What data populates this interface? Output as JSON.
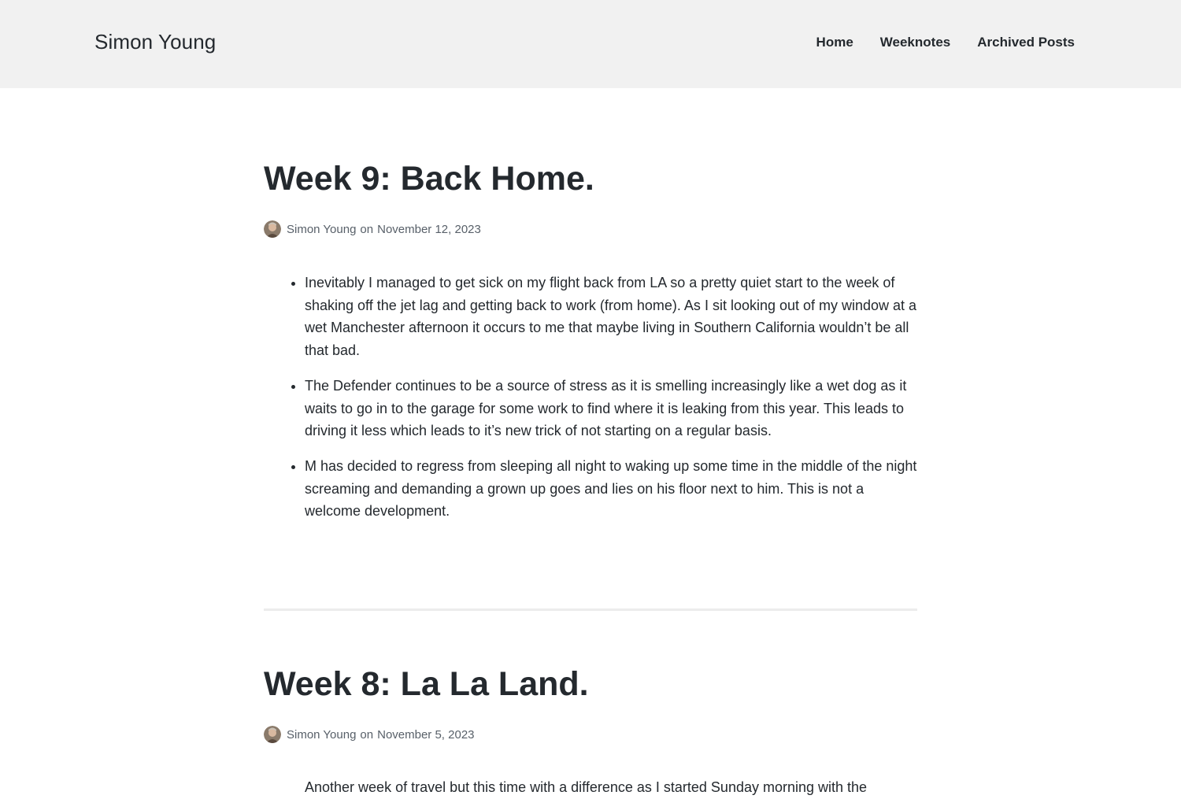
{
  "header": {
    "site_title": "Simon Young",
    "nav": [
      "Home",
      "Weeknotes",
      "Archived Posts"
    ]
  },
  "posts": [
    {
      "title": "Week 9: Back Home.",
      "author": "Simon Young",
      "on": "on",
      "date": "November 12, 2023",
      "items": [
        "Inevitably I managed to get sick on my flight back from LA so a pretty quiet start to the week of shaking off the jet lag and getting back to work (from home). As I sit looking out of my window at a wet Manchester afternoon it occurs to me that maybe living in Southern California wouldn’t be all that bad.",
        "The Defender continues to be a source of stress as it is smelling increasingly like a wet dog as it waits to go in to the garage for some work to find where it is leaking from this year. This leads to driving it less which leads to it’s new trick of not starting on a regular basis.",
        "M has decided to regress from sleeping all night to waking up some time in the middle of the night screaming and demanding a grown up goes and lies on his floor next to him. This is not a welcome development."
      ]
    },
    {
      "title": "Week 8: La La Land.",
      "author": "Simon Young",
      "on": "on",
      "date": "November 5, 2023",
      "excerpt": "Another week of travel but this time with a difference as I started Sunday morning with the"
    }
  ],
  "colors": {
    "header_bg": "#f1f1f1",
    "text": "#24292e",
    "meta": "#586069",
    "divider": "#ececec"
  }
}
